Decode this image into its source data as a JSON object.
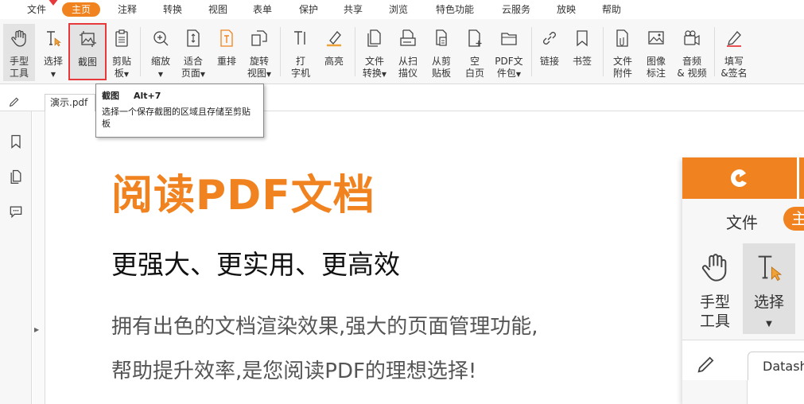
{
  "menu": {
    "items": [
      "文件",
      "主页",
      "注释",
      "转换",
      "视图",
      "表单",
      "保护",
      "共享",
      "浏览",
      "特色功能",
      "云服务",
      "放映",
      "帮助"
    ],
    "active": "主页"
  },
  "ribbon": {
    "tools": [
      {
        "label": "手型\n工具",
        "icon": "hand-icon"
      },
      {
        "label": "选择",
        "icon": "text-select-icon",
        "dropdown": true
      },
      {
        "label": "截图",
        "icon": "screenshot-icon"
      },
      {
        "label": "剪贴\n板",
        "icon": "clipboard-icon",
        "dropdown": true
      },
      {
        "label": "缩放",
        "icon": "zoom-icon",
        "dropdown": true
      },
      {
        "label": "适合\n页面",
        "icon": "fit-page-icon",
        "dropdown": true
      },
      {
        "label": "重排",
        "icon": "reflow-icon"
      },
      {
        "label": "旋转\n视图",
        "icon": "rotate-view-icon",
        "dropdown": true
      },
      {
        "label": "打\n字机",
        "icon": "typewriter-icon"
      },
      {
        "label": "高亮",
        "icon": "highlight-icon"
      },
      {
        "label": "文件\n转换",
        "icon": "file-convert-icon",
        "dropdown": true
      },
      {
        "label": "从扫\n描仪",
        "icon": "scanner-icon"
      },
      {
        "label": "从剪\n贴板",
        "icon": "from-clipboard-icon"
      },
      {
        "label": "空\n白页",
        "icon": "blank-page-icon"
      },
      {
        "label": "PDF文\n件包",
        "icon": "pdf-portfolio-icon",
        "dropdown": true
      },
      {
        "label": "链接",
        "icon": "link-icon"
      },
      {
        "label": "书签",
        "icon": "bookmark-icon"
      },
      {
        "label": "文件\n附件",
        "icon": "file-attachment-icon"
      },
      {
        "label": "图像\n标注",
        "icon": "image-annotation-icon"
      },
      {
        "label": "音频\n& 视频",
        "icon": "audio-video-icon"
      },
      {
        "label": "填写\n&签名",
        "icon": "fill-sign-icon"
      }
    ]
  },
  "tabs": {
    "document": "演示.pdf"
  },
  "tooltip": {
    "title": "截图",
    "shortcut": "Alt+7",
    "description": "选择一个保存截图的区域且存储至剪贴板"
  },
  "page": {
    "title": "阅读PDF文档",
    "subtitle": "更强大、更实用、更高效",
    "description_line1": "拥有出色的文档渲染效果,强大的页面管理功能,",
    "description_line2": "帮助提升效率,是您阅读PDF的理想选择!"
  },
  "preview": {
    "menu_file": "文件",
    "menu_home": "主",
    "tool1": "手型\n工具",
    "tool2": "选择",
    "tab": "Datash"
  },
  "colors": {
    "accent": "#f0831f",
    "highlight_border": "#e6393b"
  }
}
